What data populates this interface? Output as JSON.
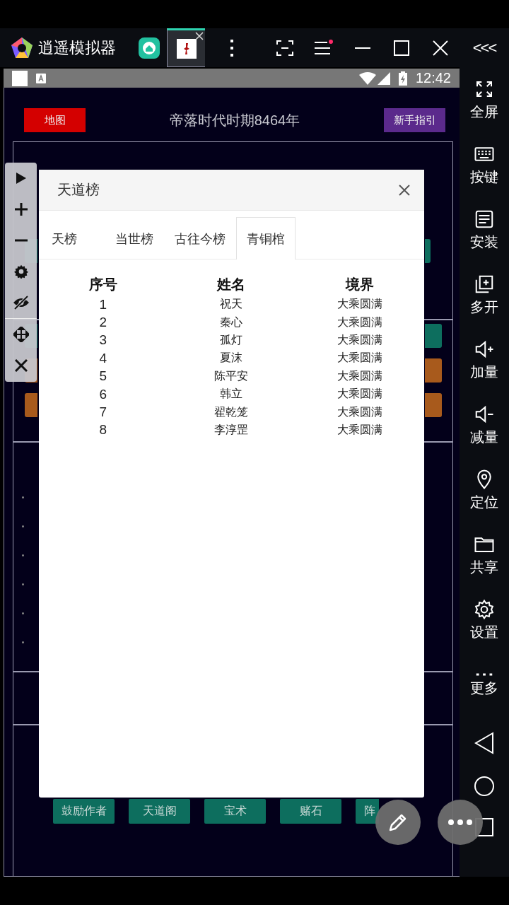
{
  "emulator": {
    "app_name": "逍遥模拟器",
    "app_tabs": [
      {
        "kind": "home",
        "selected": false
      },
      {
        "kind": "game",
        "selected": true
      }
    ],
    "collapse": "<<<"
  },
  "status_bar": {
    "time": "12:42"
  },
  "sidebar": {
    "items": [
      {
        "kind": "fullscreen",
        "label": "全屏"
      },
      {
        "kind": "keyboard",
        "label": "按键"
      },
      {
        "kind": "apk",
        "label": "安装"
      },
      {
        "kind": "multi",
        "label": "多开"
      },
      {
        "kind": "volume_up",
        "label": "加量"
      },
      {
        "kind": "volume_down",
        "label": "减量"
      },
      {
        "kind": "location",
        "label": "定位"
      },
      {
        "kind": "folder",
        "label": "共享"
      },
      {
        "kind": "settings",
        "label": "设置"
      },
      {
        "kind": "more",
        "label": "更多"
      }
    ]
  },
  "game": {
    "map_button": "地图",
    "era": "帝落时代时期8464年",
    "guide_button": "新手指引",
    "bottom_buttons": [
      "鼓励作者",
      "天道阁",
      "宝术",
      "赌石",
      "阵"
    ]
  },
  "dialog": {
    "title": "天道榜",
    "tabs": [
      {
        "label": "天榜",
        "selected": false
      },
      {
        "label": "当世榜",
        "selected": false
      },
      {
        "label": "古往今榜",
        "selected": false
      },
      {
        "label": "青铜棺",
        "selected": true
      }
    ],
    "table": {
      "columns": [
        "序号",
        "姓名",
        "境界"
      ],
      "rows": [
        [
          "1",
          "祝天",
          "大乘圆满"
        ],
        [
          "2",
          "秦心",
          "大乘圆满"
        ],
        [
          "3",
          "孤灯",
          "大乘圆满"
        ],
        [
          "4",
          "夏沫",
          "大乘圆满"
        ],
        [
          "5",
          "陈平安",
          "大乘圆满"
        ],
        [
          "6",
          "韩立",
          "大乘圆满"
        ],
        [
          "7",
          "翟乾笼",
          "大乘圆满"
        ],
        [
          "8",
          "李淳罡",
          "大乘圆满"
        ]
      ]
    }
  }
}
